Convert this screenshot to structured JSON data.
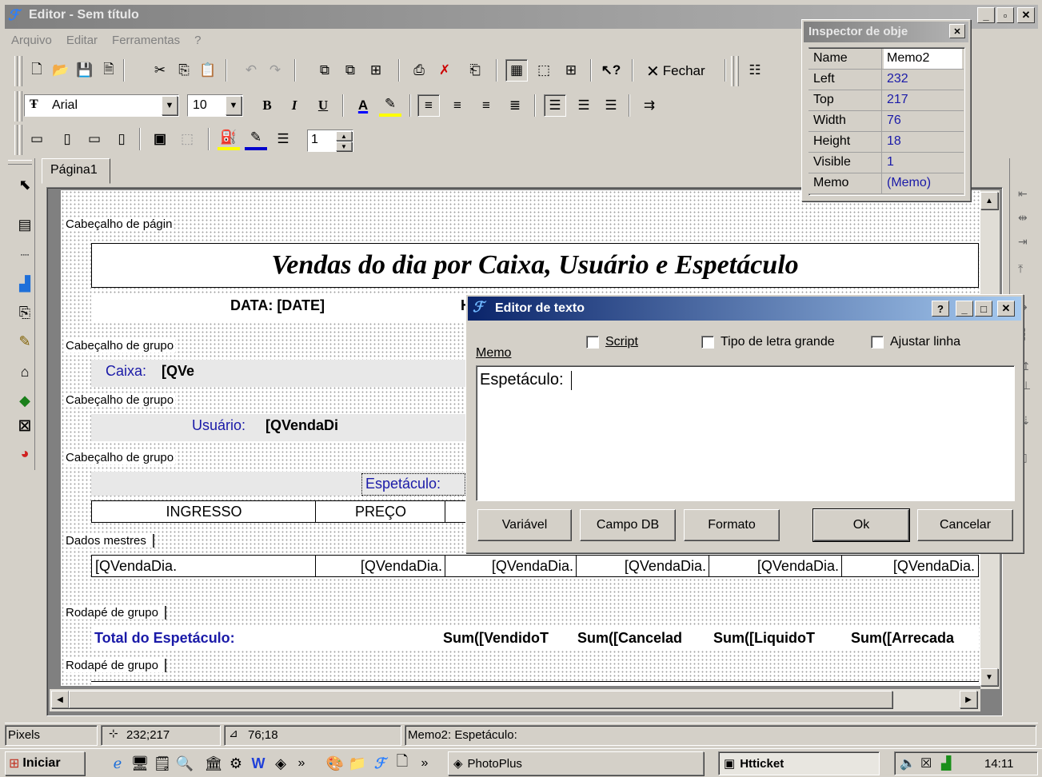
{
  "window": {
    "title": "Editor - Sem título"
  },
  "menu": [
    "Arquivo",
    "Editar",
    "Ferramentas",
    "?"
  ],
  "toolbar": {
    "close_label": "Fechar",
    "font_name": "Arial",
    "font_size": "10",
    "line_width": "1"
  },
  "tab": {
    "label": "Página1"
  },
  "inspector": {
    "title": "Inspector de obje",
    "rows": [
      {
        "name": "Name",
        "value": "Memo2"
      },
      {
        "name": "Left",
        "value": "232"
      },
      {
        "name": "Top",
        "value": "217"
      },
      {
        "name": "Width",
        "value": "76"
      },
      {
        "name": "Height",
        "value": "18"
      },
      {
        "name": "Visible",
        "value": "1"
      },
      {
        "name": "Memo",
        "value": "(Memo)"
      }
    ]
  },
  "report": {
    "page_header_label": "Cabeçalho de págin",
    "title": "Vendas do dia por Caixa, Usuário e Espetáculo",
    "date_field": "DATA: [DATE]",
    "date_partial": "H",
    "group_header_1": "Cabeçalho de grupo",
    "caixa_label": "Caixa:",
    "caixa_field": "[QVe",
    "group_header_2": "Cabeçalho de grupo",
    "usuario_label": "Usuário:",
    "usuario_field": "[QVendaDi",
    "group_header_3": "Cabeçalho de grupo",
    "espetaculo_label": "Espetáculo:",
    "col_headers": [
      "INGRESSO",
      "PREÇO"
    ],
    "master_label": "Dados mestres",
    "master_cells": [
      "[QVendaDia.",
      "[QVendaDia.",
      "[QVendaDia.",
      "[QVendaDia.",
      "[QVendaDia.",
      "[QVendaDia."
    ],
    "group_footer_1": "Rodapé de grupo",
    "total_label": "Total do Espetáculo:",
    "sums": [
      "Sum([VendidoT",
      "Sum([Cancelad",
      "Sum([LiquidoT",
      "Sum([Arrecada"
    ],
    "group_footer_2": "Rodapé de grupo"
  },
  "text_editor": {
    "title": "Editor de texto",
    "help": "?",
    "options": [
      "Script",
      "Tipo de letra grande",
      "Ajustar linha"
    ],
    "memo_label": "Memo",
    "memo_text": "Espetáculo:",
    "buttons": {
      "variable": "Variável",
      "db_field": "Campo DB",
      "format": "Formato",
      "ok": "Ok",
      "cancel": "Cancelar"
    }
  },
  "status": {
    "units": "Pixels",
    "position": "232;217",
    "size": "76;18",
    "message": "Memo2: Espetáculo:"
  },
  "taskbar": {
    "start": "Iniciar",
    "chevron": "»",
    "app1": "PhotoPlus",
    "app2": "Htticket",
    "clock": "14:11"
  },
  "colors": {
    "title_active": "#0a246a",
    "title_inactive": "#808080",
    "desktop": "#d4d0c8",
    "link_blue": "#1a1aa8"
  }
}
